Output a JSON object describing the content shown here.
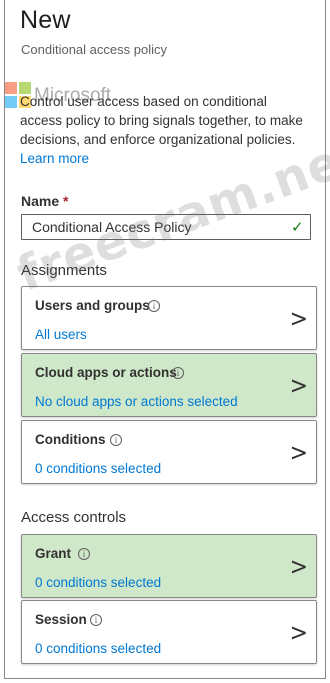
{
  "header": {
    "title": "New",
    "subtitle": "Conditional access policy"
  },
  "watermark_logo": {
    "text": "Microsoft",
    "colors": [
      "#f25022",
      "#7fba00",
      "#00a4ef",
      "#ffb900"
    ]
  },
  "description": {
    "text": "Control user access based on conditional access policy to bring signals together, to make decisions, and enforce organizational policies.",
    "link": "Learn more"
  },
  "name_field": {
    "label": "Name",
    "required_marker": "*",
    "value": "Conditional Access Policy",
    "valid_icon": "checkmark-icon"
  },
  "assignments": {
    "heading": "Assignments",
    "cards": [
      {
        "title": "Users and groups",
        "subtitle": "All users",
        "highlighted": false
      },
      {
        "title": "Cloud apps or actions",
        "subtitle": "No cloud apps or actions selected",
        "highlighted": true
      },
      {
        "title": "Conditions",
        "subtitle": "0 conditions selected",
        "highlighted": false
      }
    ]
  },
  "access_controls": {
    "heading": "Access controls",
    "cards": [
      {
        "title": "Grant",
        "subtitle": "0 conditions selected",
        "highlighted": true
      },
      {
        "title": "Session",
        "subtitle": "0 conditions selected",
        "highlighted": false
      }
    ]
  },
  "overlay_watermark": "freecram.net",
  "colors": {
    "accent": "#0078d4",
    "highlight": "#cfe8c9",
    "success": "#107c10",
    "required": "#a4262c"
  },
  "icons": {
    "info": "info-icon",
    "chevron": "chevron-right-icon"
  }
}
